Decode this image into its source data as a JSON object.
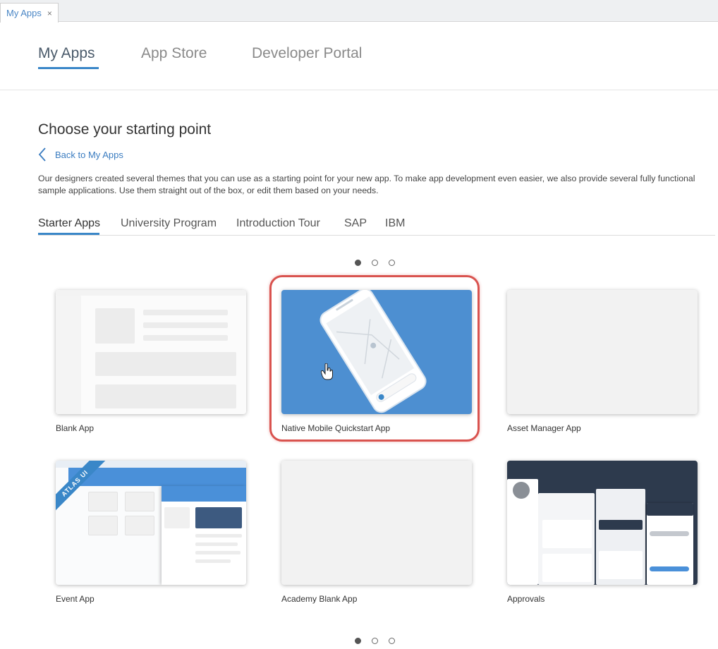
{
  "window": {
    "tab_label": "My Apps",
    "tab_close": "×"
  },
  "topnav": {
    "items": [
      "My Apps",
      "App Store",
      "Developer Portal"
    ],
    "active": "My Apps"
  },
  "page": {
    "heading": "Choose your starting point",
    "back_label": "Back to My Apps",
    "description": "Our designers created several themes that you can use as a starting point for your new app. To make app development even easier, we also provide several fully functional sample applications. Use them straight out of the box, or edit them based on your needs."
  },
  "subtabs": {
    "items": [
      "Starter Apps",
      "University Program",
      "Introduction Tour",
      "SAP",
      "IBM"
    ],
    "active": "Starter Apps"
  },
  "pagination": {
    "pages": 3,
    "current": 1
  },
  "cards": [
    {
      "label": "Blank App"
    },
    {
      "label": "Native Mobile Quickstart App",
      "highlighted": true
    },
    {
      "label": "Asset Manager App"
    },
    {
      "label": "Event App",
      "badge": "ATLAS UI"
    },
    {
      "label": "Academy Blank App"
    },
    {
      "label": "Approvals"
    }
  ],
  "colors": {
    "accent": "#3a87c8",
    "highlight": "#d9534f",
    "quickstart_bg": "#4d8fd1",
    "approvals_bg": "#2d3a4d"
  },
  "icons": {
    "back": "chevron-left-icon",
    "close": "close-icon",
    "cursor": "hand-cursor-icon"
  }
}
